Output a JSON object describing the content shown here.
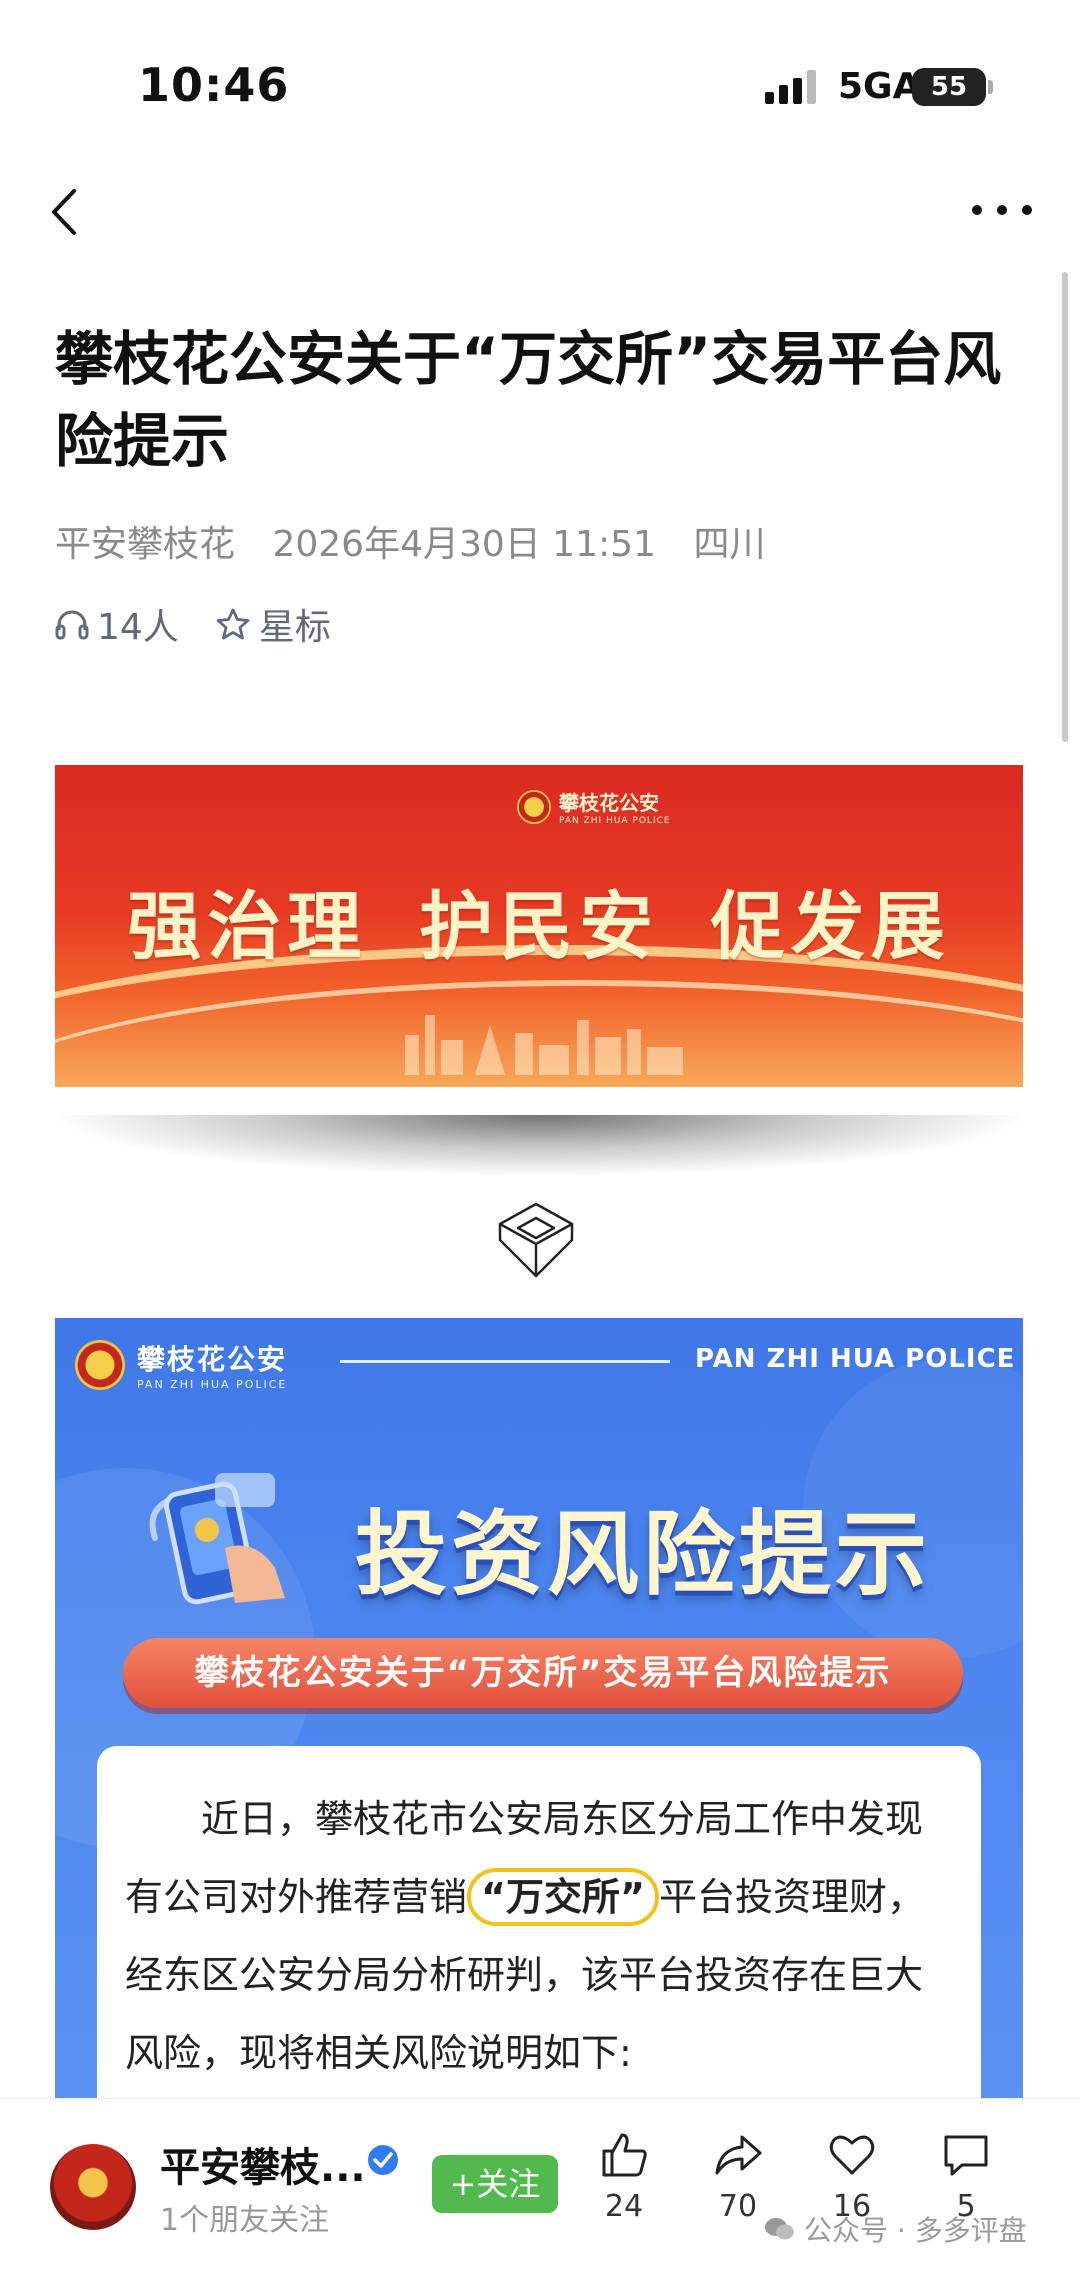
{
  "status_bar": {
    "time": "10:46",
    "network": "5GA",
    "battery": "55"
  },
  "nav": {
    "back_icon": "chevron-left-icon",
    "more_icon": "more-dots-icon"
  },
  "article": {
    "title": "攀枝花公安关于“万交所”交易平台风险提示",
    "author": "平安攀枝花",
    "date": "2026年4月30日 11:51",
    "region": "四川",
    "listeners": "14人",
    "star_label": "星标"
  },
  "banner": {
    "logo_cn": "攀枝花公安",
    "logo_en": "PAN ZHI HUA POLICE",
    "slogan": "强治理 护民安 促发展"
  },
  "poster": {
    "logo_cn": "攀枝花公安",
    "logo_en": "PAN ZHI HUA POLICE",
    "header_en": "PAN ZHI HUA POLICE",
    "headline": "投资风险提示",
    "ribbon": "攀枝花公安关于“万交所”交易平台风险提示",
    "body_part1": "近日，攀枝花市公安局东区分局工作中发现有公司对外推荐营销",
    "body_highlight": "“万交所”",
    "body_part2": "平台投资理财，经东区公安分局分析研判，该平台投资存在巨大风险，现将相关风险说明如下:"
  },
  "bottom_bar": {
    "account_name": "平安攀枝...",
    "follow_sub": "1个朋友关注",
    "follow_label": "+关注",
    "like_count": "24",
    "share_count": "70",
    "favorite_count": "16",
    "comment_count": "5",
    "watermark": "公众号 · 多多评盘"
  }
}
